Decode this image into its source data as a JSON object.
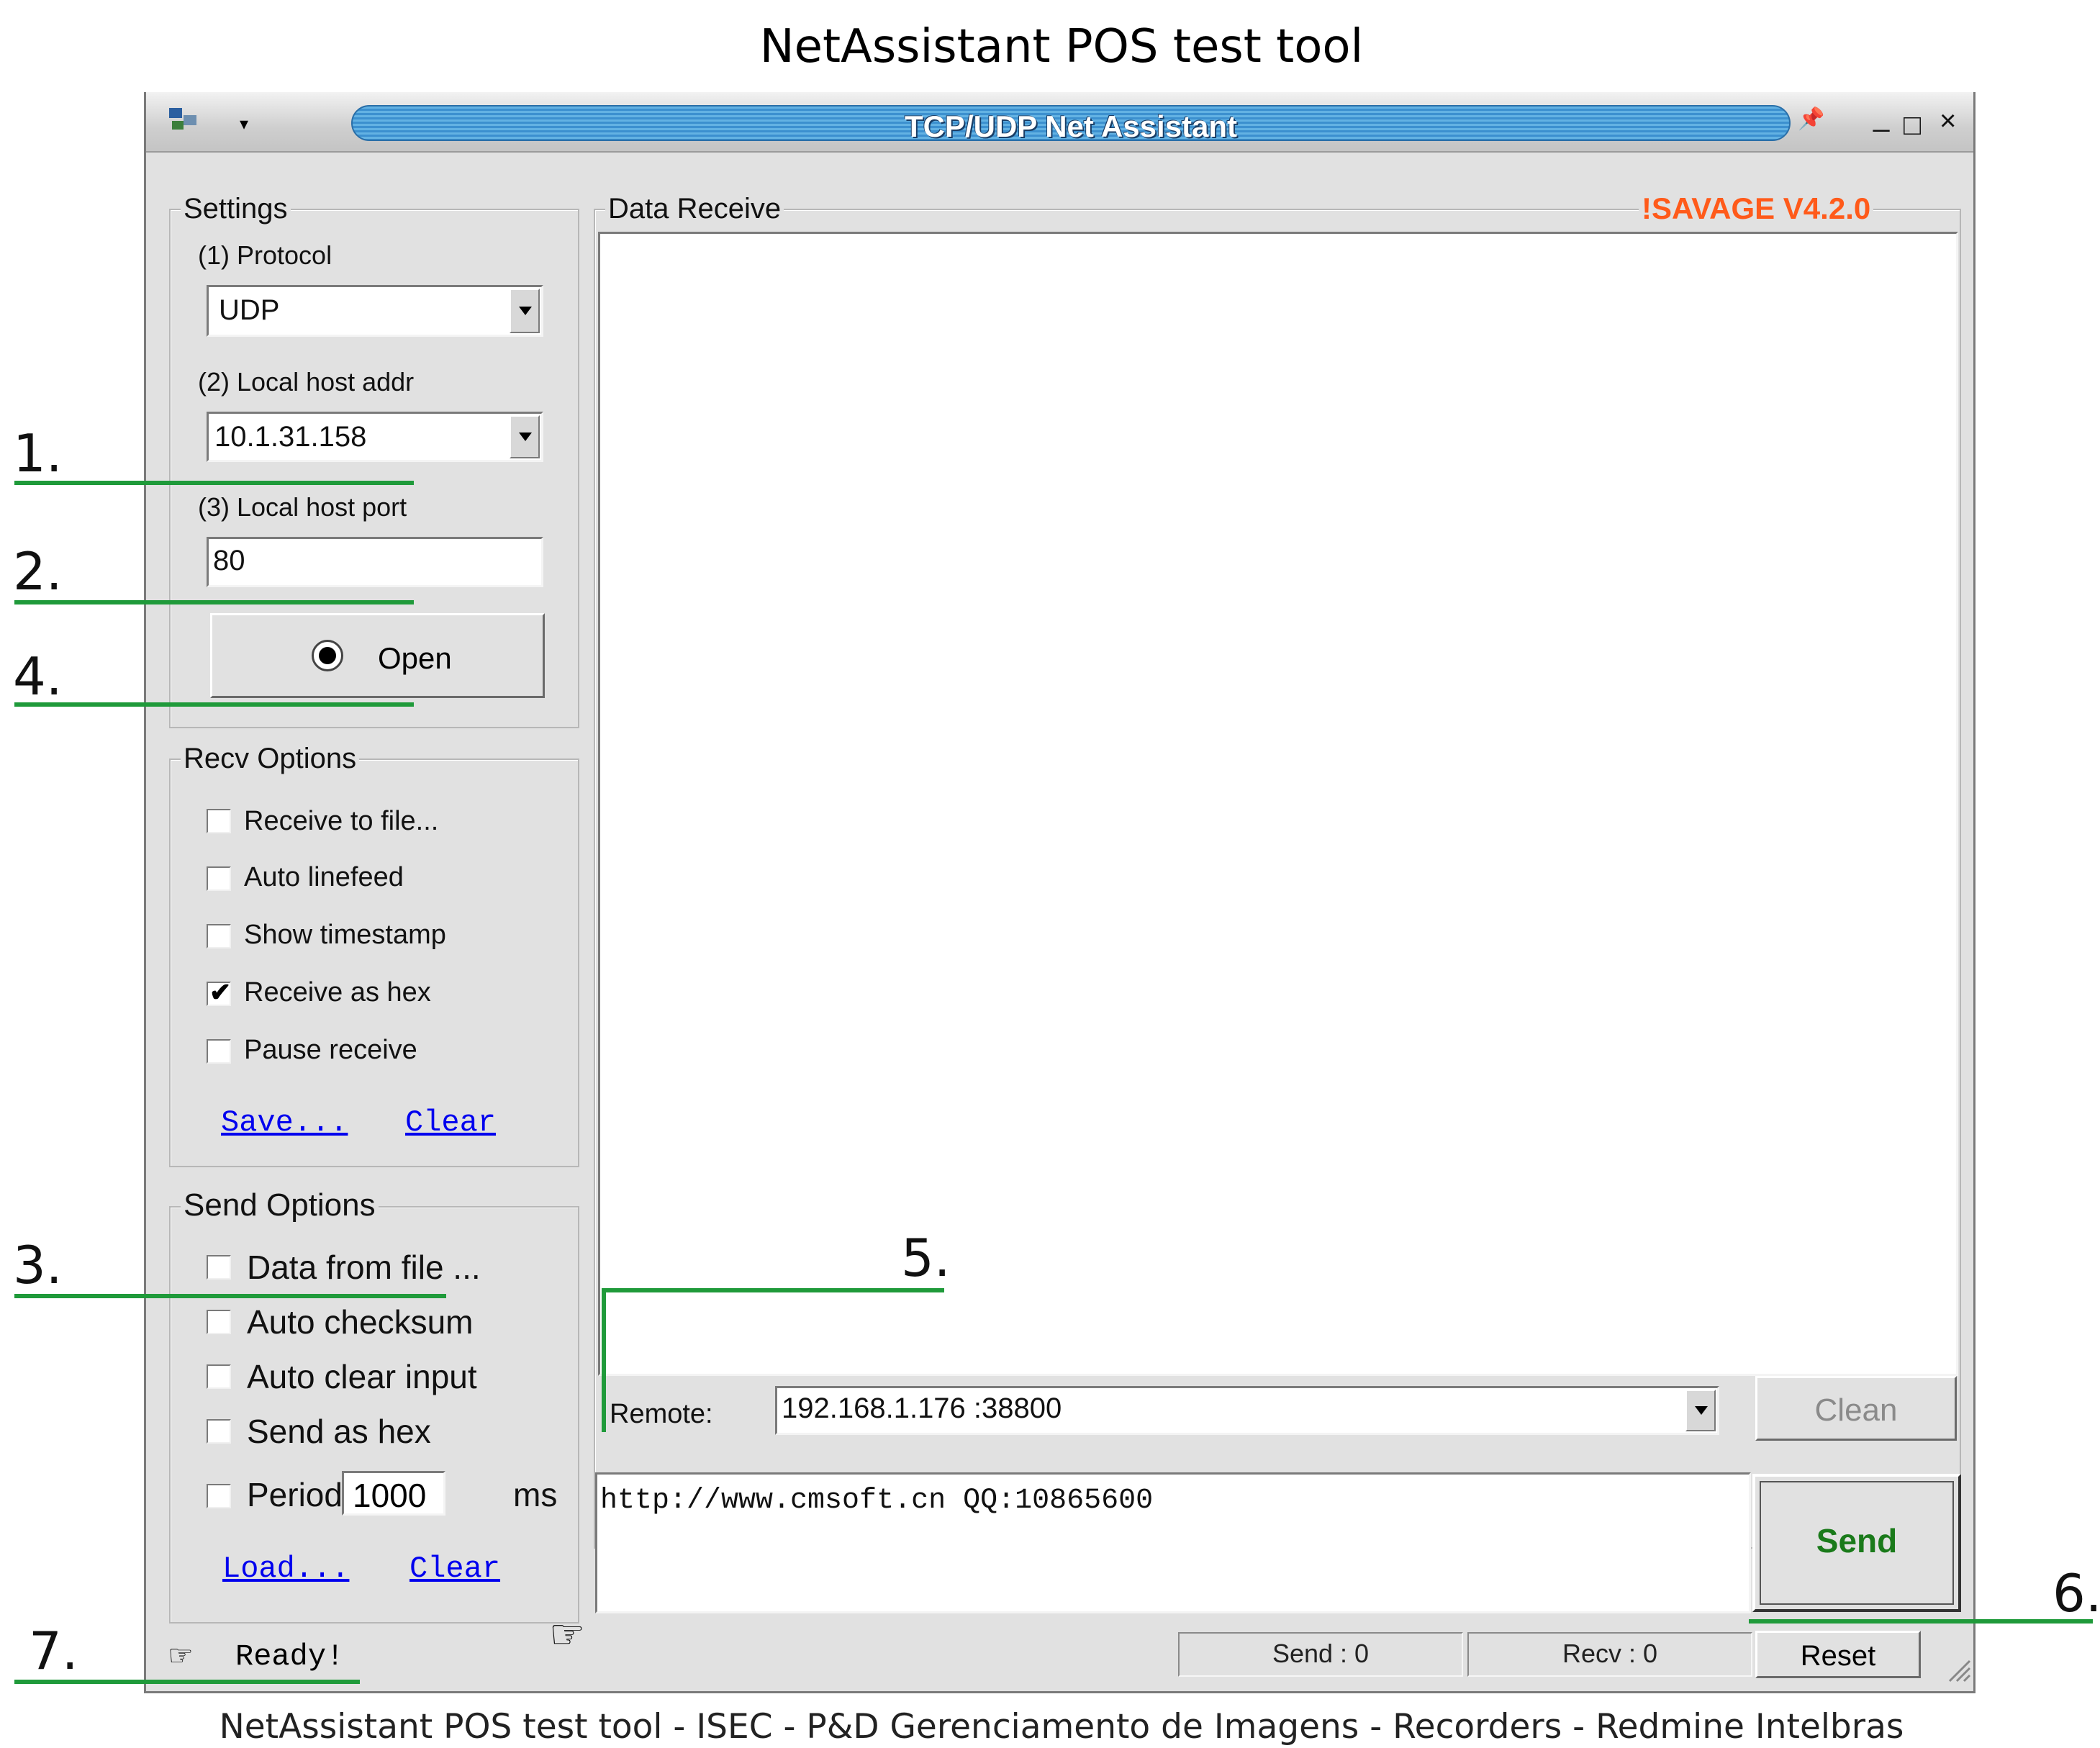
{
  "page": {
    "title": "NetAssistant POS test tool",
    "caption": "NetAssistant POS test tool - ISEC - P&D Gerenciamento de Imagens - Recorders - Redmine Intelbras"
  },
  "window": {
    "title": "TCP/UDP Net Assistant",
    "version": "!SAVAGE V4.2.0",
    "controls": {
      "pin": "📌",
      "minimize": "_",
      "maximize": "□",
      "close": "×"
    }
  },
  "settings": {
    "legend": "Settings",
    "protocol_label": "(1) Protocol",
    "protocol_value": "UDP",
    "host_addr_label": "(2) Local host addr",
    "host_addr_value": "10.1.31.158",
    "host_port_label": "(3) Local host port",
    "host_port_value": "80",
    "open_label": "Open"
  },
  "recv_options": {
    "legend": "Recv Options",
    "items": [
      {
        "label": "Receive to file...",
        "checked": false
      },
      {
        "label": "Auto linefeed",
        "checked": false
      },
      {
        "label": "Show timestamp",
        "checked": false
      },
      {
        "label": "Receive as hex",
        "checked": true
      },
      {
        "label": "Pause receive",
        "checked": false
      }
    ],
    "save_link": "Save...",
    "clear_link": "Clear"
  },
  "send_options": {
    "legend": "Send Options",
    "items": [
      {
        "label": "Data from file ...",
        "checked": false
      },
      {
        "label": "Auto checksum",
        "checked": false
      },
      {
        "label": "Auto clear input",
        "checked": false
      },
      {
        "label": "Send as hex",
        "checked": false
      }
    ],
    "period_label": "Period",
    "period_value": "1000",
    "period_unit": "ms",
    "load_link": "Load...",
    "clear_link": "Clear"
  },
  "data_receive": {
    "legend": "Data Receive",
    "remote_label": "Remote:",
    "remote_value": "192.168.1.176 :38800",
    "clean_label": "Clean"
  },
  "send_area": {
    "text": "http://www.cmsoft.cn QQ:10865600",
    "send_label": "Send"
  },
  "status": {
    "ready": "Ready!",
    "send_count": "Send : 0",
    "recv_count": "Recv : 0",
    "reset_label": "Reset"
  },
  "annotations": [
    "1.",
    "2.",
    "4.",
    "3.",
    "5.",
    "6.",
    "7."
  ],
  "colors": {
    "annotation": "#1f9a3a",
    "version": "#ff5a1a",
    "send_text": "#1a7a1a",
    "link": "#0000ee"
  }
}
